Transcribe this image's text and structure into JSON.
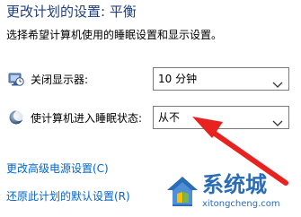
{
  "page": {
    "title": "更改计划的设置: 平衡",
    "subtitle": "选择希望计算机使用的睡眠设置和显示设置。"
  },
  "settings": [
    {
      "icon": "monitor-clock-icon",
      "label": "关闭显示器:",
      "value": "10 分钟"
    },
    {
      "icon": "moon-sleep-icon",
      "label": "使计算机进入睡眠状态:",
      "value": "从不"
    }
  ],
  "links": {
    "advanced": "更改高级电源设置(C)",
    "restore": "还原此计划的默认设置(R)"
  },
  "annotation": {
    "arrow_color": "#e8231f"
  },
  "watermark": {
    "brand": "系统城",
    "url": "xitongcheng.com",
    "color": "#2a6cb5"
  },
  "colors": {
    "title": "#1f3f7a",
    "link": "#0066cc"
  }
}
